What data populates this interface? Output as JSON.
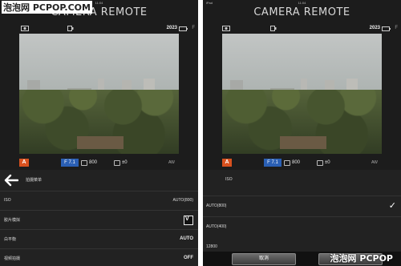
{
  "watermark": {
    "top": "泡泡网 PCPOP.COM",
    "bottom": "泡泡网 PCPOP"
  },
  "left": {
    "status_time": "11:04",
    "app_title": "CAMERA REMOTE",
    "shots_remaining": "2023",
    "film_label": "F",
    "mode": "A",
    "aperture": "F 7.1",
    "iso": "800",
    "exposure_comp": "±0",
    "wb_label": "AW",
    "menu": {
      "header": "拍摄菜单",
      "items": [
        {
          "label": "ISO",
          "value": "AUTO(800)"
        },
        {
          "label": "胶片模拟",
          "value": ""
        },
        {
          "label": "白平衡",
          "value": "AUTO"
        },
        {
          "label": "视频拍摄",
          "value": "OFF"
        }
      ]
    }
  },
  "right": {
    "carrier": "iPad",
    "status_time": "11:04",
    "app_title": "CAMERA REMOTE",
    "shots_remaining": "2023",
    "film_label": "F",
    "mode": "A",
    "aperture": "F 7.1",
    "iso": "800",
    "exposure_comp": "±0",
    "wb_label": "AW",
    "menu": {
      "header": "ISO",
      "options": [
        {
          "label": "AUTO(800)",
          "selected": true
        },
        {
          "label": "AUTO(400)",
          "selected": false
        },
        {
          "label": "12800",
          "selected": false
        }
      ],
      "cancel_label": "取消",
      "ok_label": "OK"
    }
  },
  "colors": {
    "mode_badge": "#d8511f",
    "aperture_badge": "#2a5fb4",
    "panel_bg": "#1c1c1c"
  }
}
